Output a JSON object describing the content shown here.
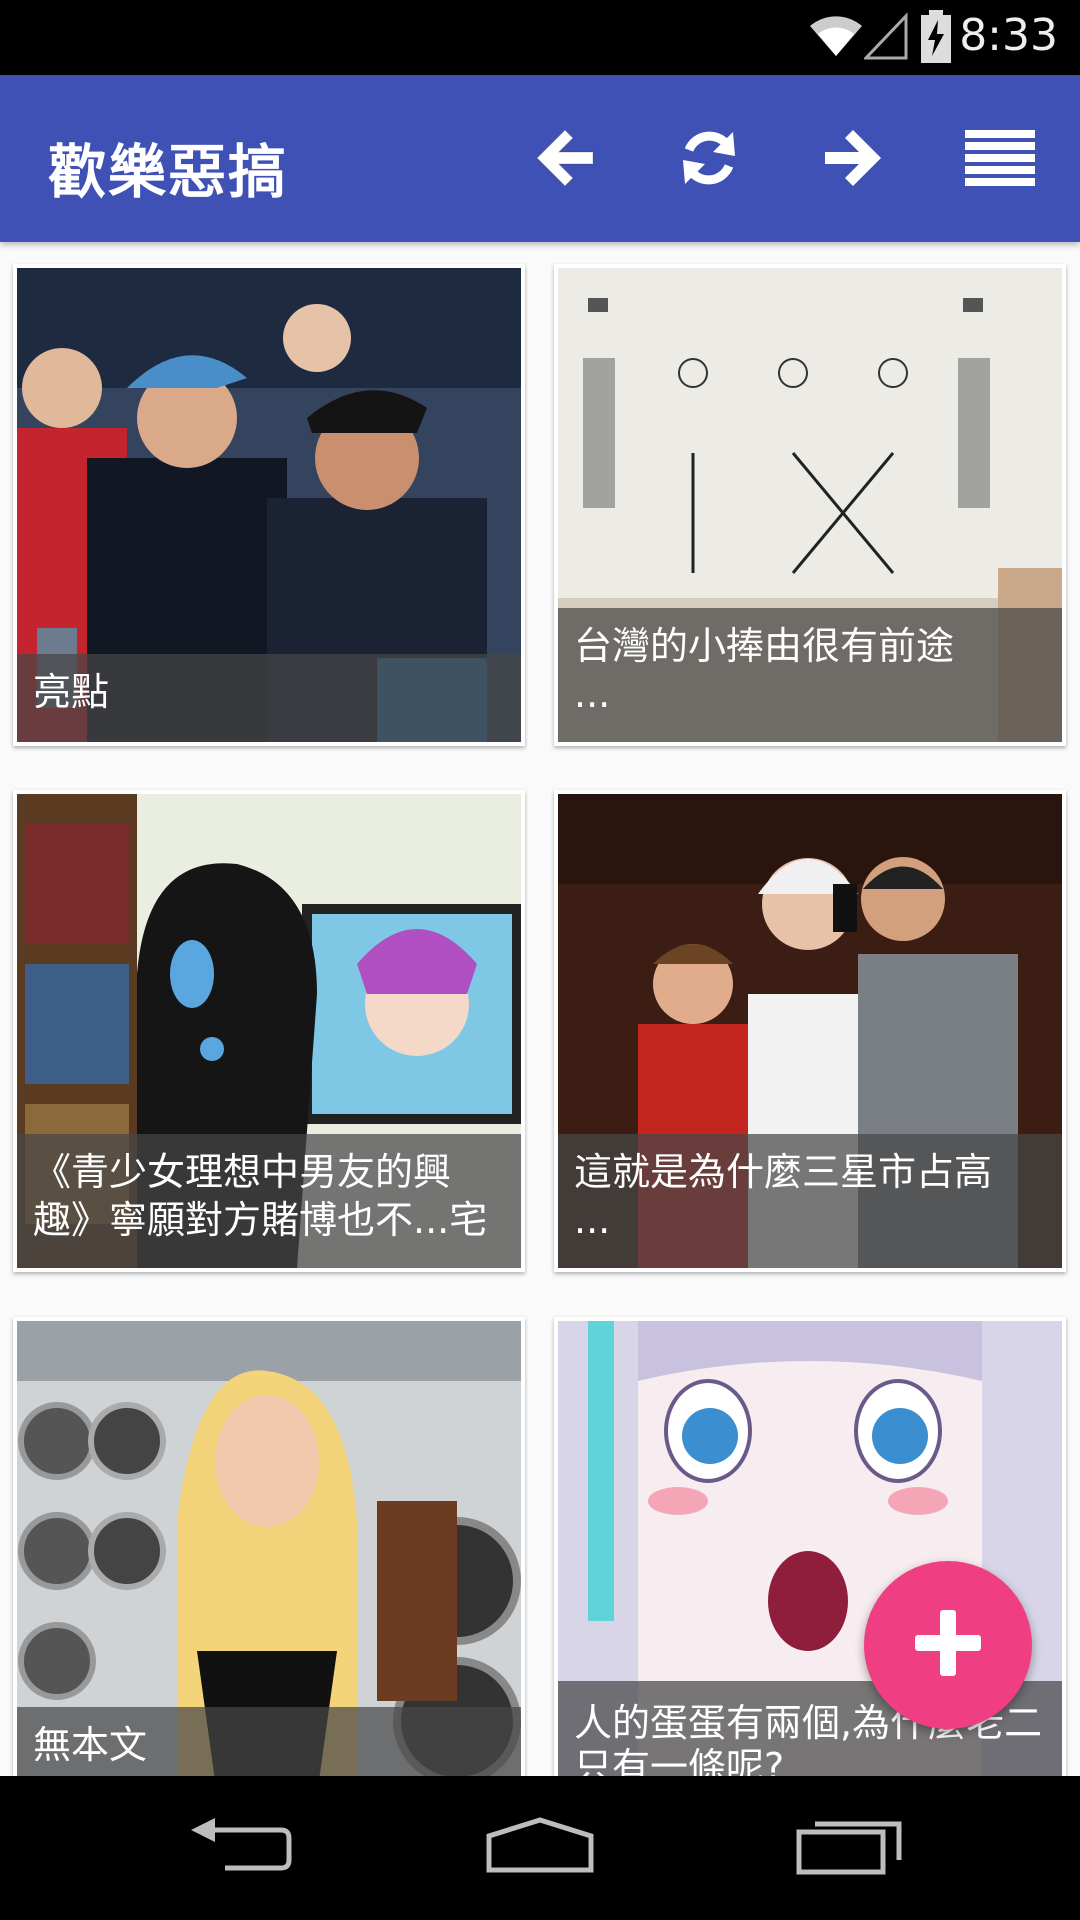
{
  "status_bar": {
    "time": "8:33",
    "icons": [
      "wifi-icon",
      "signal-icon",
      "battery-charging-icon"
    ]
  },
  "app_bar": {
    "title": "歡樂惡搞",
    "actions": [
      "back-arrow-icon",
      "refresh-icon",
      "forward-arrow-icon",
      "menu-icon"
    ],
    "color": "#3f51b5"
  },
  "cards": [
    {
      "caption": "亮點",
      "image": "baseball-fans-photo"
    },
    {
      "caption": "台灣的小捧由很有前途\n...",
      "image": "worksheet-photo"
    },
    {
      "caption": "《青少女理想中男友的興趣》寧願對方賭博也不...宅",
      "image": "anime-screenshot"
    },
    {
      "caption": "這就是為什麼三星市占高\n...",
      "image": "selfie-photo"
    },
    {
      "caption": "無本文",
      "image": "wheels-model-photo"
    },
    {
      "caption": "人的蛋蛋有兩個,為什麼老二只有一條呢?",
      "image": "anime-girl-image"
    }
  ],
  "fab": {
    "icon": "plus-icon",
    "color": "#ef3f82"
  },
  "nav_bar": {
    "icons": [
      "back-icon",
      "home-icon",
      "recents-icon"
    ]
  }
}
